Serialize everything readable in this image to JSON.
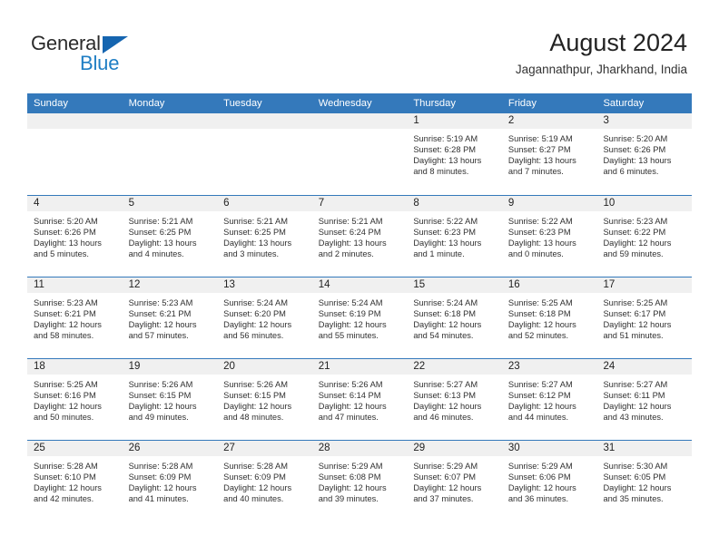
{
  "brand": {
    "name_part1": "General",
    "name_part2": "Blue",
    "triangle_color": "#1565b0",
    "blue_color": "#1f7ec4"
  },
  "header": {
    "title": "August 2024",
    "subtitle": "Jagannathpur, Jharkhand, India"
  },
  "theme": {
    "header_blue": "#3479bb",
    "daynum_band": "#f0f0f0",
    "text": "#303030"
  },
  "weekdays": [
    "Sunday",
    "Monday",
    "Tuesday",
    "Wednesday",
    "Thursday",
    "Friday",
    "Saturday"
  ],
  "weeks": [
    [
      {
        "day": "",
        "sunrise": "",
        "sunset": "",
        "daylight": "",
        "empty": true
      },
      {
        "day": "",
        "sunrise": "",
        "sunset": "",
        "daylight": "",
        "empty": true
      },
      {
        "day": "",
        "sunrise": "",
        "sunset": "",
        "daylight": "",
        "empty": true
      },
      {
        "day": "",
        "sunrise": "",
        "sunset": "",
        "daylight": "",
        "empty": true
      },
      {
        "day": "1",
        "sunrise": "Sunrise: 5:19 AM",
        "sunset": "Sunset: 6:28 PM",
        "daylight": "Daylight: 13 hours and 8 minutes."
      },
      {
        "day": "2",
        "sunrise": "Sunrise: 5:19 AM",
        "sunset": "Sunset: 6:27 PM",
        "daylight": "Daylight: 13 hours and 7 minutes."
      },
      {
        "day": "3",
        "sunrise": "Sunrise: 5:20 AM",
        "sunset": "Sunset: 6:26 PM",
        "daylight": "Daylight: 13 hours and 6 minutes."
      }
    ],
    [
      {
        "day": "4",
        "sunrise": "Sunrise: 5:20 AM",
        "sunset": "Sunset: 6:26 PM",
        "daylight": "Daylight: 13 hours and 5 minutes."
      },
      {
        "day": "5",
        "sunrise": "Sunrise: 5:21 AM",
        "sunset": "Sunset: 6:25 PM",
        "daylight": "Daylight: 13 hours and 4 minutes."
      },
      {
        "day": "6",
        "sunrise": "Sunrise: 5:21 AM",
        "sunset": "Sunset: 6:25 PM",
        "daylight": "Daylight: 13 hours and 3 minutes."
      },
      {
        "day": "7",
        "sunrise": "Sunrise: 5:21 AM",
        "sunset": "Sunset: 6:24 PM",
        "daylight": "Daylight: 13 hours and 2 minutes."
      },
      {
        "day": "8",
        "sunrise": "Sunrise: 5:22 AM",
        "sunset": "Sunset: 6:23 PM",
        "daylight": "Daylight: 13 hours and 1 minute."
      },
      {
        "day": "9",
        "sunrise": "Sunrise: 5:22 AM",
        "sunset": "Sunset: 6:23 PM",
        "daylight": "Daylight: 13 hours and 0 minutes."
      },
      {
        "day": "10",
        "sunrise": "Sunrise: 5:23 AM",
        "sunset": "Sunset: 6:22 PM",
        "daylight": "Daylight: 12 hours and 59 minutes."
      }
    ],
    [
      {
        "day": "11",
        "sunrise": "Sunrise: 5:23 AM",
        "sunset": "Sunset: 6:21 PM",
        "daylight": "Daylight: 12 hours and 58 minutes."
      },
      {
        "day": "12",
        "sunrise": "Sunrise: 5:23 AM",
        "sunset": "Sunset: 6:21 PM",
        "daylight": "Daylight: 12 hours and 57 minutes."
      },
      {
        "day": "13",
        "sunrise": "Sunrise: 5:24 AM",
        "sunset": "Sunset: 6:20 PM",
        "daylight": "Daylight: 12 hours and 56 minutes."
      },
      {
        "day": "14",
        "sunrise": "Sunrise: 5:24 AM",
        "sunset": "Sunset: 6:19 PM",
        "daylight": "Daylight: 12 hours and 55 minutes."
      },
      {
        "day": "15",
        "sunrise": "Sunrise: 5:24 AM",
        "sunset": "Sunset: 6:18 PM",
        "daylight": "Daylight: 12 hours and 54 minutes."
      },
      {
        "day": "16",
        "sunrise": "Sunrise: 5:25 AM",
        "sunset": "Sunset: 6:18 PM",
        "daylight": "Daylight: 12 hours and 52 minutes."
      },
      {
        "day": "17",
        "sunrise": "Sunrise: 5:25 AM",
        "sunset": "Sunset: 6:17 PM",
        "daylight": "Daylight: 12 hours and 51 minutes."
      }
    ],
    [
      {
        "day": "18",
        "sunrise": "Sunrise: 5:25 AM",
        "sunset": "Sunset: 6:16 PM",
        "daylight": "Daylight: 12 hours and 50 minutes."
      },
      {
        "day": "19",
        "sunrise": "Sunrise: 5:26 AM",
        "sunset": "Sunset: 6:15 PM",
        "daylight": "Daylight: 12 hours and 49 minutes."
      },
      {
        "day": "20",
        "sunrise": "Sunrise: 5:26 AM",
        "sunset": "Sunset: 6:15 PM",
        "daylight": "Daylight: 12 hours and 48 minutes."
      },
      {
        "day": "21",
        "sunrise": "Sunrise: 5:26 AM",
        "sunset": "Sunset: 6:14 PM",
        "daylight": "Daylight: 12 hours and 47 minutes."
      },
      {
        "day": "22",
        "sunrise": "Sunrise: 5:27 AM",
        "sunset": "Sunset: 6:13 PM",
        "daylight": "Daylight: 12 hours and 46 minutes."
      },
      {
        "day": "23",
        "sunrise": "Sunrise: 5:27 AM",
        "sunset": "Sunset: 6:12 PM",
        "daylight": "Daylight: 12 hours and 44 minutes."
      },
      {
        "day": "24",
        "sunrise": "Sunrise: 5:27 AM",
        "sunset": "Sunset: 6:11 PM",
        "daylight": "Daylight: 12 hours and 43 minutes."
      }
    ],
    [
      {
        "day": "25",
        "sunrise": "Sunrise: 5:28 AM",
        "sunset": "Sunset: 6:10 PM",
        "daylight": "Daylight: 12 hours and 42 minutes."
      },
      {
        "day": "26",
        "sunrise": "Sunrise: 5:28 AM",
        "sunset": "Sunset: 6:09 PM",
        "daylight": "Daylight: 12 hours and 41 minutes."
      },
      {
        "day": "27",
        "sunrise": "Sunrise: 5:28 AM",
        "sunset": "Sunset: 6:09 PM",
        "daylight": "Daylight: 12 hours and 40 minutes."
      },
      {
        "day": "28",
        "sunrise": "Sunrise: 5:29 AM",
        "sunset": "Sunset: 6:08 PM",
        "daylight": "Daylight: 12 hours and 39 minutes."
      },
      {
        "day": "29",
        "sunrise": "Sunrise: 5:29 AM",
        "sunset": "Sunset: 6:07 PM",
        "daylight": "Daylight: 12 hours and 37 minutes."
      },
      {
        "day": "30",
        "sunrise": "Sunrise: 5:29 AM",
        "sunset": "Sunset: 6:06 PM",
        "daylight": "Daylight: 12 hours and 36 minutes."
      },
      {
        "day": "31",
        "sunrise": "Sunrise: 5:30 AM",
        "sunset": "Sunset: 6:05 PM",
        "daylight": "Daylight: 12 hours and 35 minutes."
      }
    ]
  ]
}
